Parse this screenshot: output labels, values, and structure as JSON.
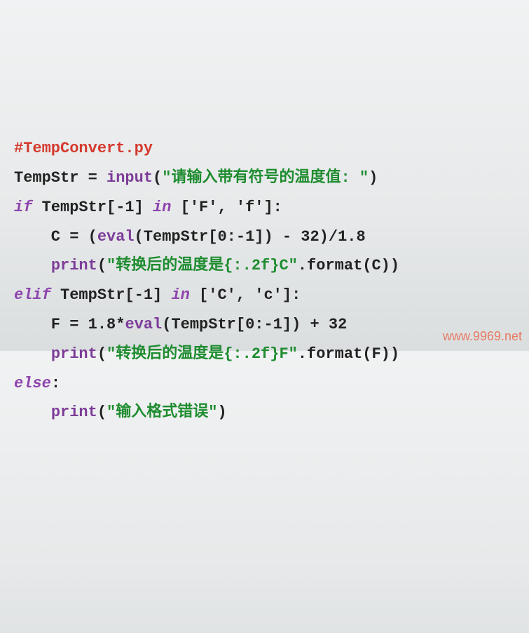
{
  "code": {
    "comment": "#TempConvert.py",
    "assign1_lhs": "TempStr = ",
    "input_fn": "input",
    "input_arg_open": "(",
    "input_str": "\"请输入带有符号的温度值: \"",
    "input_arg_close": ")",
    "if_kw": "if",
    "if_cond_a": " TempStr[-1] ",
    "in_kw": "in",
    "if_list": " ['F', 'f']:",
    "c_assign": "    C = (",
    "eval_fn": "eval",
    "c_eval_arg": "(TempStr[0:-1]) - 32)/1.8",
    "indent4": "    ",
    "print_fn": "print",
    "print1_open": "(",
    "print1_str": "\"转换后的温度是{:.2f}C\"",
    "print1_rest": ".format(C))",
    "elif_kw": "elif",
    "elif_cond_a": " TempStr[-1] ",
    "elif_list": " ['C', 'c']:",
    "f_assign": "    F = 1.8*",
    "f_eval_arg": "(TempStr[0:-1]) + 32",
    "print2_open": "(",
    "print2_str": "\"转换后的温度是{:.2f}F\"",
    "print2_rest": ".format(F))",
    "else_kw": "else",
    "else_colon": ":",
    "print3_open": "(",
    "print3_str": "\"输入格式错误\"",
    "print3_close": ")"
  },
  "watermark": "www.9969.net"
}
